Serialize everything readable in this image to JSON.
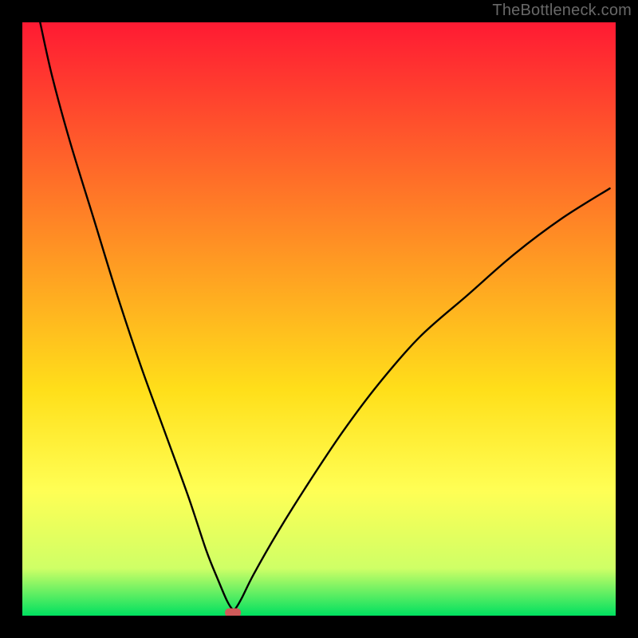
{
  "watermark": "TheBottleneck.com",
  "chart_data": {
    "type": "line",
    "title": "",
    "xlabel": "",
    "ylabel": "",
    "xlim": [
      0,
      100
    ],
    "ylim": [
      0,
      100
    ],
    "grid": false,
    "legend": false,
    "background_gradient": [
      "#ff1a33",
      "#ffdf1a",
      "#00e060"
    ],
    "series": [
      {
        "name": "bottleneck-curve",
        "color": "#000000",
        "x": [
          3,
          5,
          8,
          12,
          16,
          20,
          24,
          28,
          31,
          33,
          34.5,
          35.5,
          36,
          37,
          39,
          43,
          48,
          54,
          60,
          67,
          75,
          83,
          91,
          99
        ],
        "y": [
          100,
          91,
          80,
          67,
          54,
          42,
          31,
          20,
          11,
          6,
          2.5,
          1,
          1.3,
          3,
          7,
          14,
          22,
          31,
          39,
          47,
          54,
          61,
          67,
          72
        ]
      }
    ],
    "marker": {
      "name": "optimal-point",
      "color": "#cf5a5a",
      "x": 35.5,
      "y": 0.5,
      "shape": "rounded-rect"
    }
  }
}
